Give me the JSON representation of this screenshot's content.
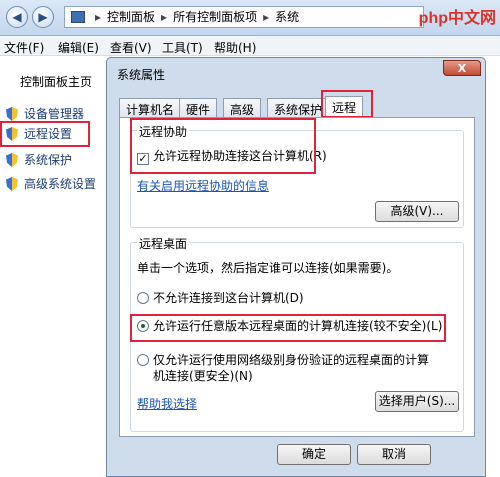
{
  "explorer": {
    "breadcrumb": [
      "控制面板",
      "所有控制面板项",
      "系统"
    ],
    "logo": "php中文网",
    "menu": [
      "文件(F)",
      "编辑(E)",
      "查看(V)",
      "工具(T)",
      "帮助(H)"
    ],
    "left_title": "控制面板主页",
    "left_items": [
      "设备管理器",
      "远程设置",
      "系统保护",
      "高级系统设置"
    ]
  },
  "dialog": {
    "title": "系统属性",
    "close": "X",
    "tabs": [
      "计算机名",
      "硬件",
      "高级",
      "系统保护",
      "远程"
    ],
    "active_tab": "远程",
    "assist": {
      "group_title": "远程协助",
      "checkbox_label": "允许远程协助连接这台计算机(R)",
      "checkbox_checked": true,
      "link": "有关启用远程协助的信息",
      "advanced_button": "高级(V)..."
    },
    "desktop": {
      "group_title": "远程桌面",
      "instruction": "单击一个选项，然后指定谁可以连接(如果需要)。",
      "option1": "不允许连接到这台计算机(D)",
      "option2": "允许运行任意版本远程桌面的计算机连接(较不安全)(L)",
      "option3_line1": "仅允许运行使用网络级别身份验证的远程桌面的计算",
      "option3_line2": "机连接(更安全)(N)",
      "selected": 2,
      "help_link": "帮助我选择",
      "select_users_button": "选择用户(S)..."
    },
    "ok_button": "确定",
    "cancel_button": "取消"
  },
  "colors": {
    "highlight_outline": "#e0233d",
    "link": "#1a56b8"
  }
}
